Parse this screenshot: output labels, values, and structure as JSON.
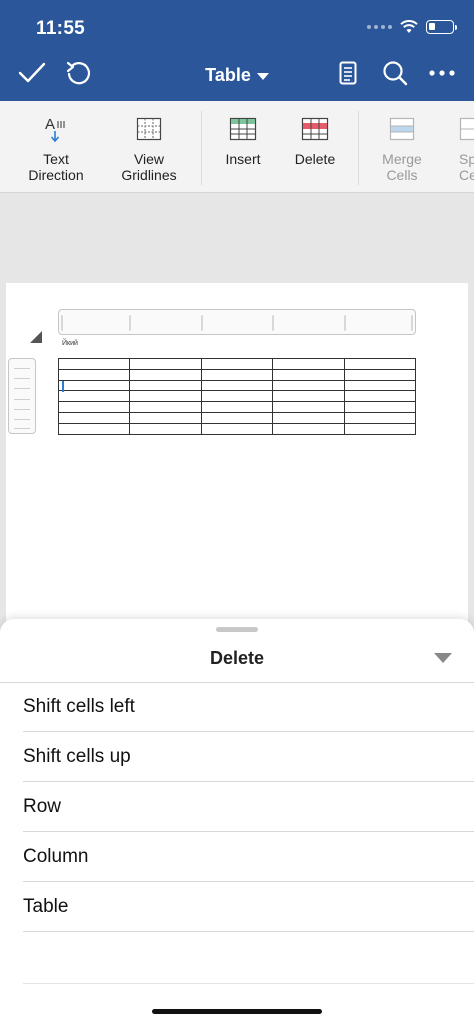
{
  "status": {
    "time": "11:55"
  },
  "nav": {
    "title": "Table",
    "icons": [
      "checkmark-icon",
      "undo-icon",
      "reading-view-icon",
      "search-icon",
      "more-icon"
    ]
  },
  "ribbon": {
    "items": [
      {
        "label": "Text\nDirection",
        "icon": "text-direction-icon",
        "enabled": true
      },
      {
        "label": "View\nGridlines",
        "icon": "view-gridlines-icon",
        "enabled": true
      },
      {
        "label": "Insert",
        "icon": "insert-table-icon",
        "enabled": true
      },
      {
        "label": "Delete",
        "icon": "delete-table-icon",
        "enabled": true
      },
      {
        "label": "Merge\nCells",
        "icon": "merge-cells-icon",
        "enabled": false
      },
      {
        "label": "Sp\nCe",
        "icon": "split-cells-icon",
        "enabled": false
      }
    ]
  },
  "document": {
    "text": "Йкий",
    "table": {
      "rows": 7,
      "cols": 5
    }
  },
  "sheet": {
    "title": "Delete",
    "options": [
      "Shift cells left",
      "Shift cells up",
      "Row",
      "Column",
      "Table"
    ]
  },
  "colors": {
    "accent": "#2b579a",
    "cursor": "#2b7cd3"
  }
}
